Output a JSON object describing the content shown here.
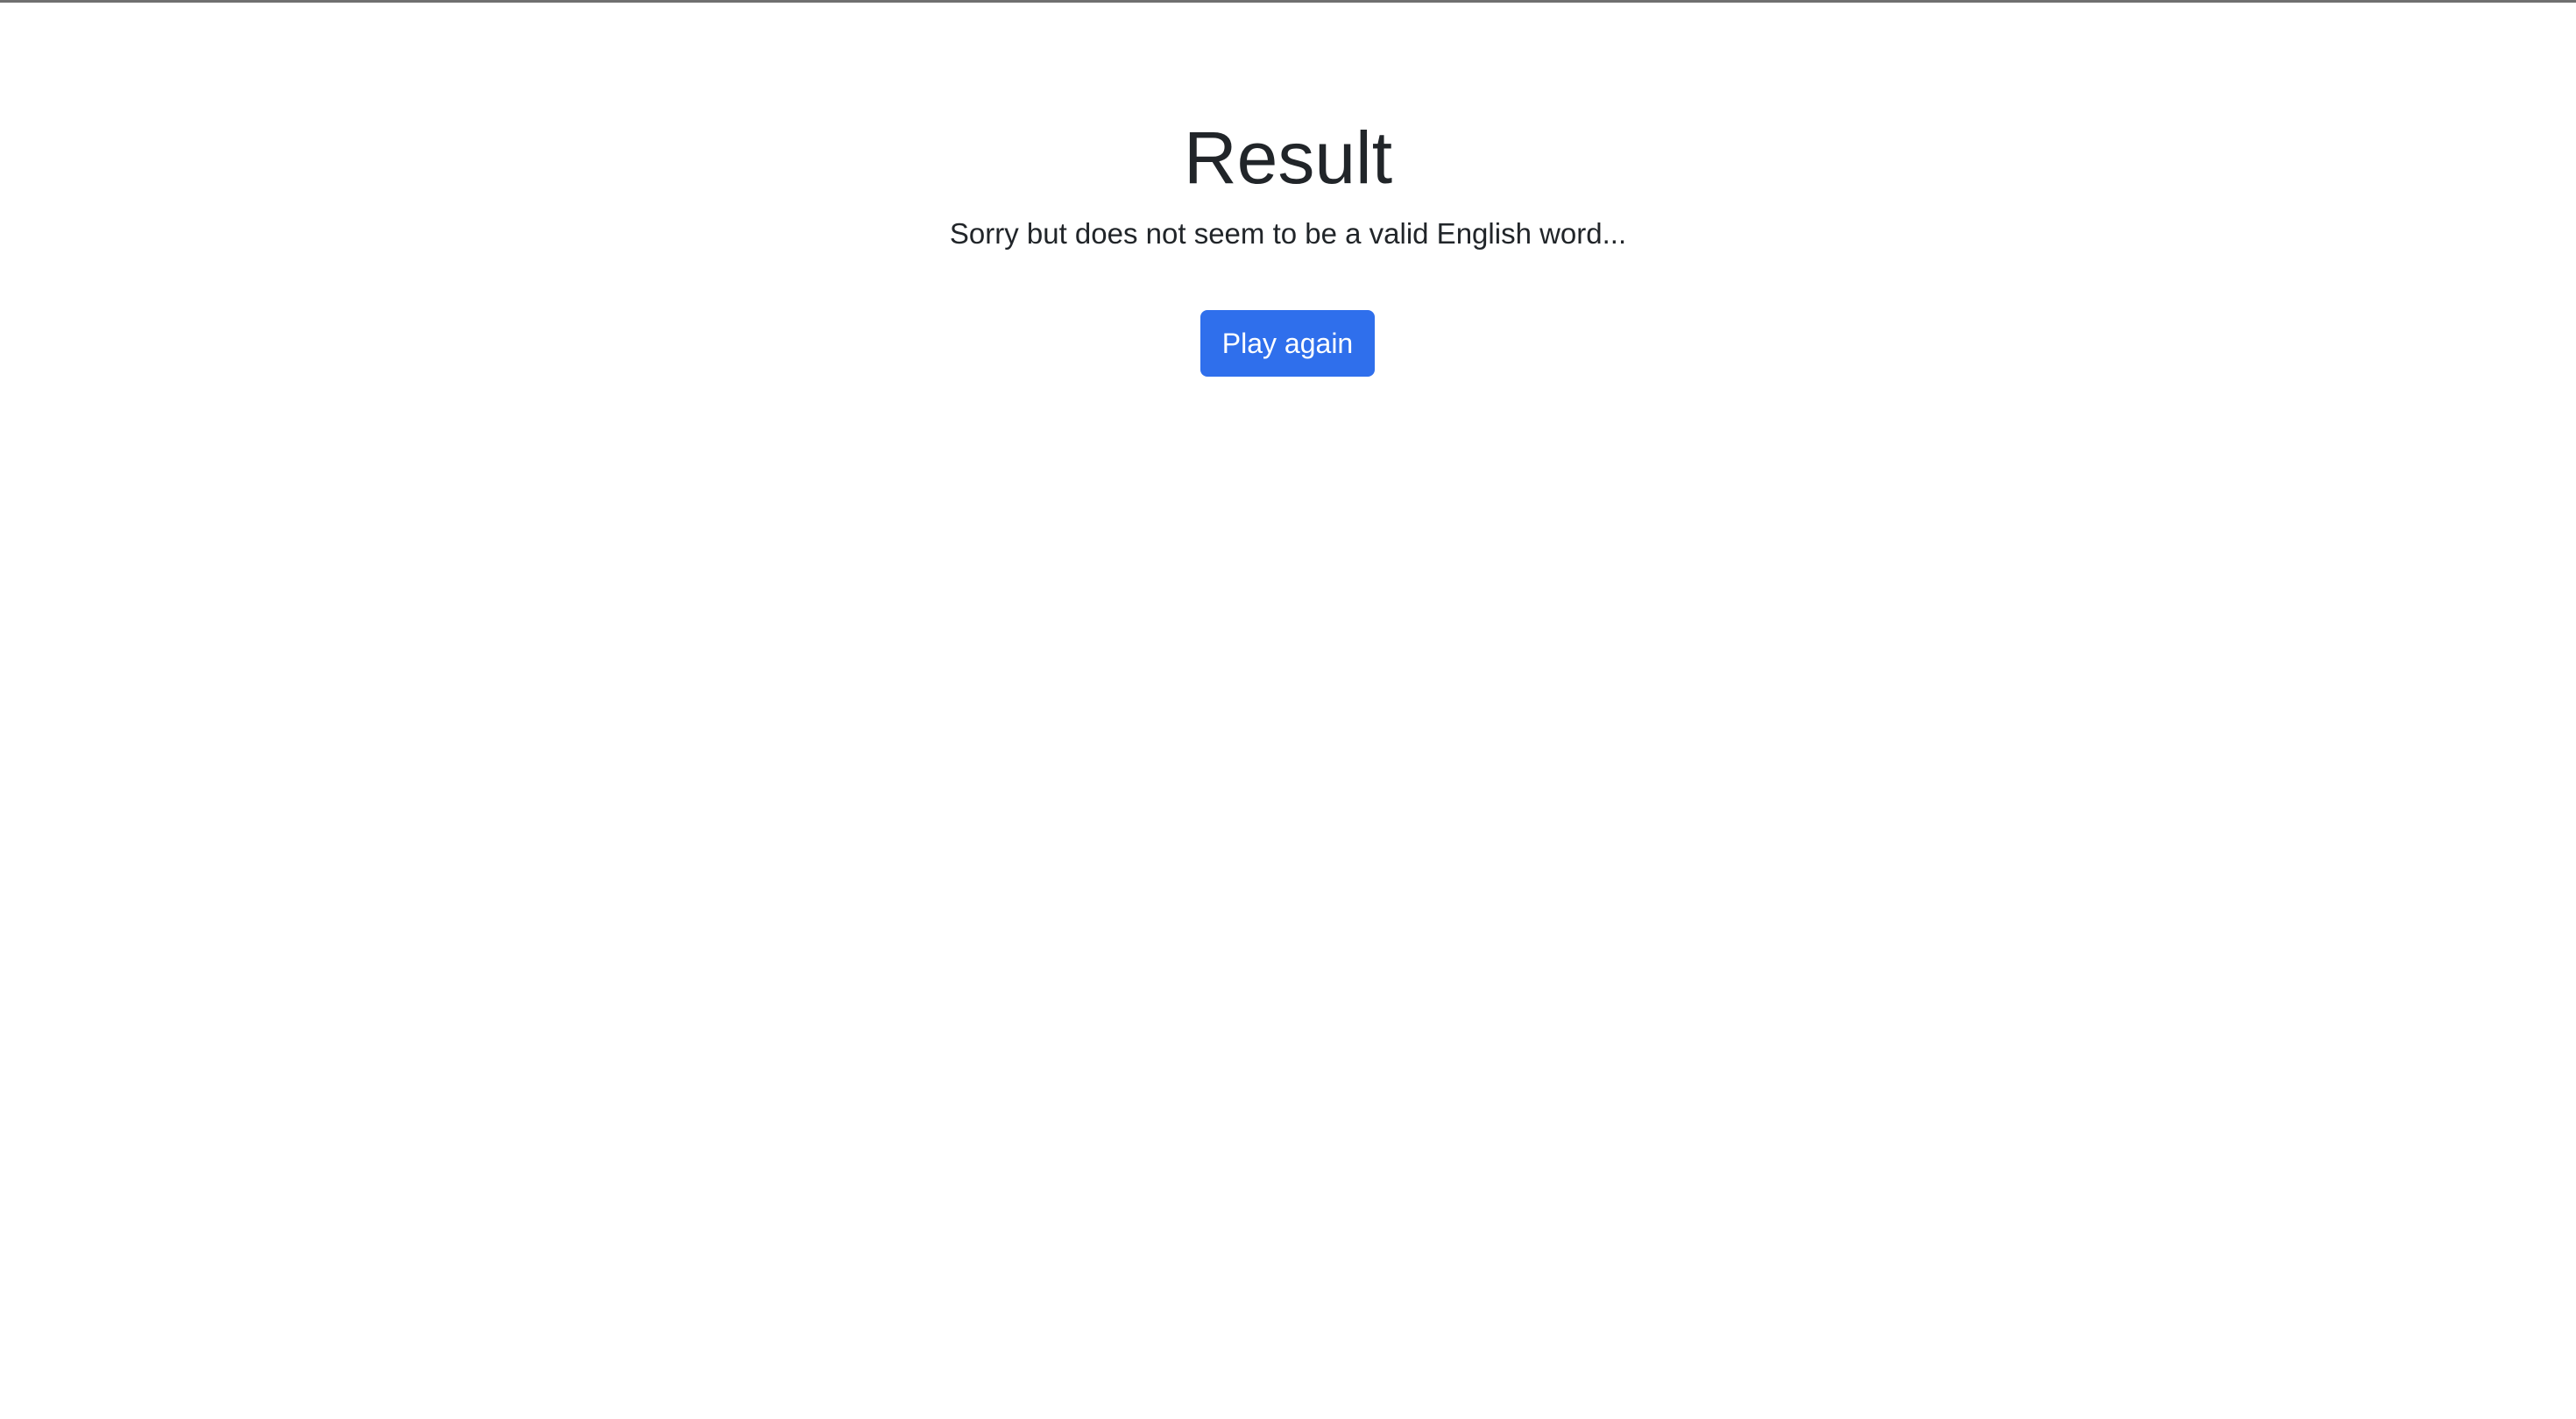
{
  "result": {
    "title": "Result",
    "message": "Sorry but does not seem to be a valid English word...",
    "play_again_label": "Play again"
  },
  "colors": {
    "primary": "#2f6fec",
    "text": "#212529",
    "top_border": "#707070"
  }
}
